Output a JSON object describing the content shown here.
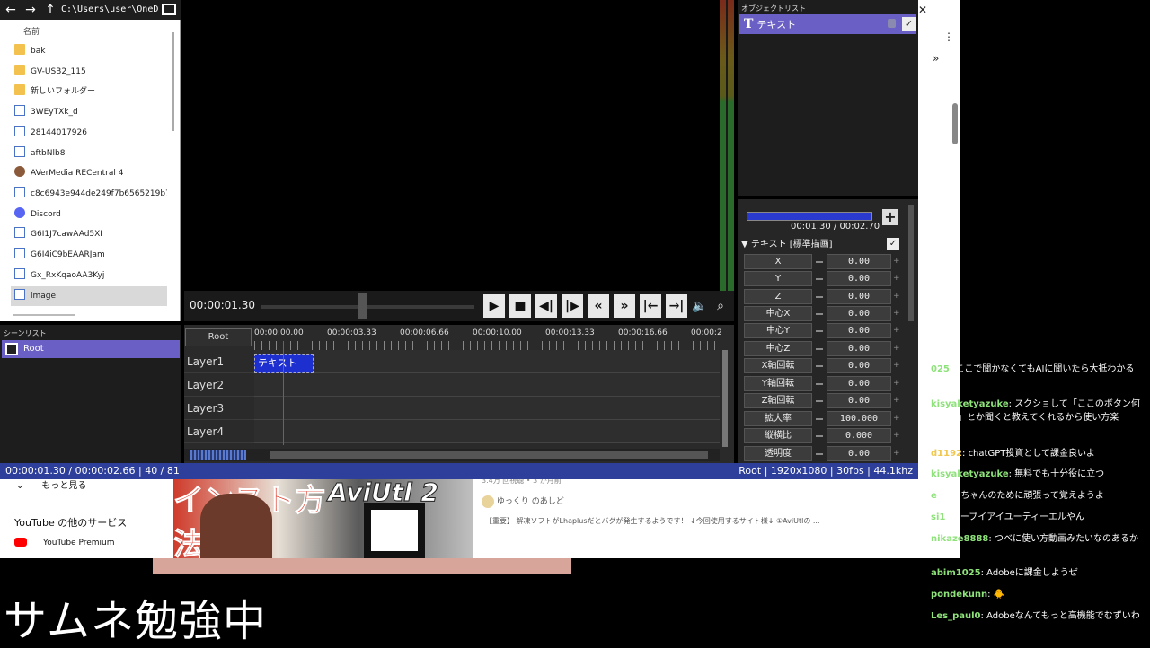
{
  "explorer": {
    "path": "C:\\Users\\user\\OneD",
    "column_header": "名前",
    "files": [
      {
        "name": "bak",
        "icon": "folder-icon"
      },
      {
        "name": "GV-USB2_115",
        "icon": "folder-icon"
      },
      {
        "name": "新しいフォルダー",
        "icon": "folder-icon"
      },
      {
        "name": "3WEyTXk_d",
        "icon": "file-icon"
      },
      {
        "name": "28144017926",
        "icon": "file-icon"
      },
      {
        "name": "aftbNlb8",
        "icon": "file-icon"
      },
      {
        "name": "AVerMedia RECentral 4",
        "icon": "app-icon"
      },
      {
        "name": "c8c6943e944de249f7b6565219b7726f",
        "icon": "file-icon"
      },
      {
        "name": "Discord",
        "icon": "discord-icon"
      },
      {
        "name": "G6I1J7cawAAd5XI",
        "icon": "file-icon"
      },
      {
        "name": "G6I4iC9bEAARJam",
        "icon": "file-icon"
      },
      {
        "name": "Gx_RxKqaoAA3Kyj",
        "icon": "file-icon"
      },
      {
        "name": "image",
        "icon": "file-icon",
        "selected": true
      }
    ]
  },
  "scene_list": {
    "title": "シーンリスト",
    "items": [
      "Root"
    ]
  },
  "preview": {
    "timecode": "00:00:01.30"
  },
  "timeline": {
    "root_tab": "Root",
    "ticks": [
      "00:00:00.00",
      "00:00:03.33",
      "00:00:06.66",
      "00:00:10.00",
      "00:00:13.33",
      "00:00:16.66",
      "00:00:2"
    ],
    "layers": [
      "Layer1",
      "Layer2",
      "Layer3",
      "Layer4"
    ],
    "clip_label": "テキスト"
  },
  "object_list": {
    "title": "オブジェクトリスト",
    "items": [
      {
        "label": "テキスト",
        "icon": "text-T-icon"
      }
    ]
  },
  "properties": {
    "time": "00:01.30 / 00:02.70",
    "header": "テキスト [標準描画]",
    "params": [
      {
        "label": "X",
        "value": "0.00"
      },
      {
        "label": "Y",
        "value": "0.00"
      },
      {
        "label": "Z",
        "value": "0.00"
      },
      {
        "label": "中心X",
        "value": "0.00"
      },
      {
        "label": "中心Y",
        "value": "0.00"
      },
      {
        "label": "中心Z",
        "value": "0.00"
      },
      {
        "label": "X軸回転",
        "value": "0.00"
      },
      {
        "label": "Y軸回転",
        "value": "0.00"
      },
      {
        "label": "Z軸回転",
        "value": "0.00"
      },
      {
        "label": "拡大率",
        "value": "100.000"
      },
      {
        "label": "縦横比",
        "value": "0.000"
      },
      {
        "label": "透明度",
        "value": "0.00"
      }
    ]
  },
  "status": {
    "left": "00:00:01.30 / 00:00:02.66  |  40 / 81",
    "right": "Root  |  1920x1080  |  30fps  |  44.1khz"
  },
  "youtube": {
    "show_more": "もっと見る",
    "other_services": "YouTube の他のサービス",
    "premium": "YouTube Premium",
    "video_meta": "3.4万 回視聴 • 3 か月前",
    "channel": "ゆっくり のあしど",
    "description": "【重要】 解凍ソフトがLhaplusだとバグが発生するようです！ ↓今回使用するサイト様↓ ①AviUtlの ...",
    "thumb_title": "AviUtl 2",
    "thumb_headline": "インスト方法"
  },
  "caption": "サムネ勉強中",
  "chat": [
    {
      "name": "025",
      "text": "ここで聞かなくてもAIに聞いたら大抵わかるな"
    },
    {
      "name": "kisyaketyazuke",
      "text": "スクショして「ここのボタン何なの？」とか聞くと教えてくれるから使い方楽"
    },
    {
      "name": "d1192",
      "text": "chatGPT投資として課金良いよ"
    },
    {
      "name": "kisyaketyazuke",
      "text": "無料でも十分役に立つ"
    },
    {
      "name": "e",
      "text": "くーちゃんのために頑張って覚えようよ"
    },
    {
      "name": "si1",
      "text": "エーブイアイユーティーエルやん"
    },
    {
      "name": "nikaze8888",
      "text": "つべに使い方動画みたいなのあるかな"
    },
    {
      "name": "abim1025",
      "text": "Adobeに課金しようぜ"
    },
    {
      "name": "pondekunn",
      "text": "🐥"
    },
    {
      "name": "Les_paul0",
      "text": "Adobeなんてもっと高機能でむずいわ"
    }
  ]
}
